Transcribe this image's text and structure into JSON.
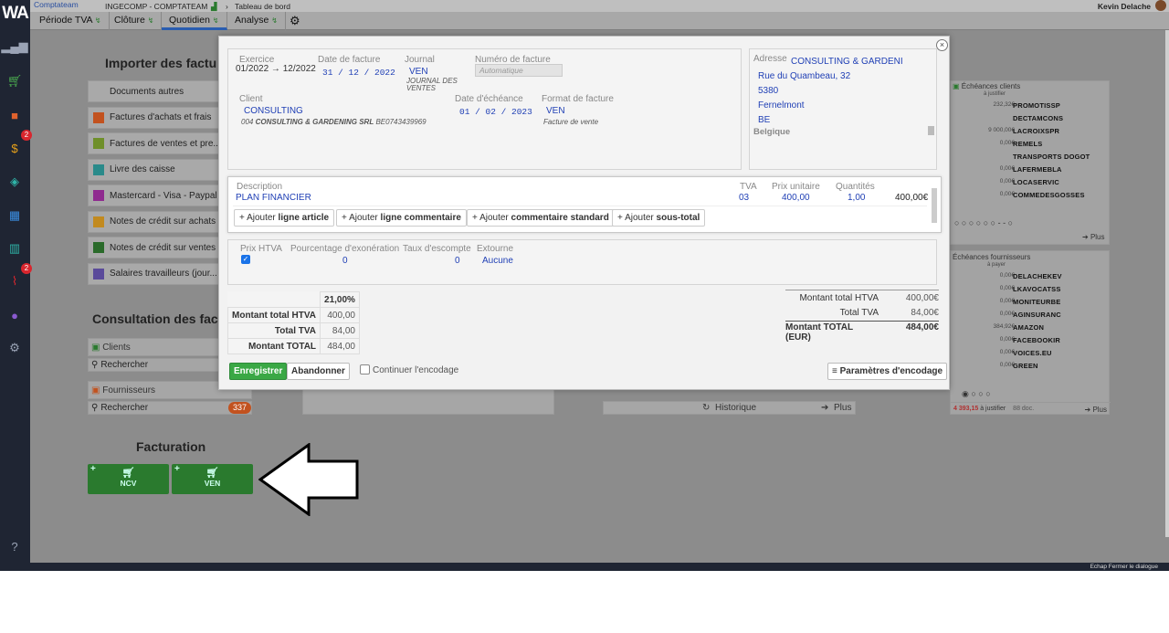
{
  "app": {
    "logo": "WA",
    "brand": "Comptateam",
    "company": "INGECOMP - COMPTATEAM",
    "breadcrumb": "Tableau de bord",
    "user": "Kevin Delache",
    "footer_hint": "Echap Fermer le dialogue"
  },
  "sidebar": {
    "badge_money": "2",
    "badge_attach": "2"
  },
  "tabs": [
    {
      "label": "Période TVA"
    },
    {
      "label": "Clôture"
    },
    {
      "label": "Quotidien"
    },
    {
      "label": "Analyse"
    }
  ],
  "left": {
    "import_title": "Importer des factu",
    "import_items": [
      {
        "label": "Documents autres",
        "color": "#a9a9a9"
      },
      {
        "label": "Factures d'achats et frais",
        "color": "#c2521f"
      },
      {
        "label": "Factures de ventes et pre...",
        "color": "#6f8f2a"
      },
      {
        "label": "Livre des caisse",
        "color": "#2a8a8a"
      },
      {
        "label": "Mastercard - Visa - Paypal",
        "color": "#8f2a8f"
      },
      {
        "label": "Notes de crédit sur achats",
        "color": "#c28a1f"
      },
      {
        "label": "Notes de crédit sur ventes",
        "color": "#2a6a2a"
      },
      {
        "label": "Salaires travailleurs (jour...",
        "color": "#5a4a9a"
      }
    ],
    "consult_title": "Consultation des fac",
    "clients_label": "Clients",
    "clients_search": "Rechercher",
    "suppliers_label": "Fournisseurs",
    "suppliers_search": "Rechercher",
    "suppliers_count": "337",
    "invoicing_title": "Facturation",
    "btn_ncv": "NCV",
    "btn_ven": "VEN"
  },
  "middle": {
    "historique": "Historique",
    "plus": "Plus"
  },
  "right": {
    "clients_title": "Échéances clients",
    "clients_sub": "à justifier",
    "clients": [
      {
        "amount": "232,32€",
        "name": "PROMOTISSP"
      },
      {
        "amount": "",
        "name": "DECTAMCONS"
      },
      {
        "amount": "9 000,00€",
        "name": "LACROIXSPR"
      },
      {
        "amount": "0,00€",
        "name": "REMELS"
      },
      {
        "amount": "",
        "name": "TRANSPORTS DOGOT"
      },
      {
        "amount": "0,00€",
        "name": "LAFERMEBLA"
      },
      {
        "amount": "0,00€",
        "name": "LOCASERVIC"
      },
      {
        "amount": "0,00€",
        "name": "COMMEDESGOSSES"
      }
    ],
    "suppliers_title": "Échéances fournisseurs",
    "suppliers_sub": "à payer",
    "suppliers": [
      {
        "amount": "0,00€",
        "name": "DELACHEKEV"
      },
      {
        "amount": "0,00€",
        "name": "LKAVOCATSS"
      },
      {
        "amount": "0,00€",
        "name": "MONITEURBE"
      },
      {
        "amount": "0,00€",
        "name": "AGINSURANC"
      },
      {
        "amount": "384,92€",
        "name": "AMAZON"
      },
      {
        "amount": "0,00€",
        "name": "FACEBOOKIR"
      },
      {
        "amount": "0,00€",
        "name": "VOICES.EU"
      },
      {
        "amount": "0,00€",
        "name": "GREEN"
      }
    ],
    "plus": "Plus",
    "total_amount": "4 393,15",
    "total_suffix": "à justifier",
    "total_docs": "88 doc."
  },
  "modal": {
    "exercice_label": "Exercice",
    "exercice_value": "01/2022 → 12/2022",
    "date_facture_label": "Date de facture",
    "date_facture": {
      "d": "31",
      "m": "12",
      "y": "2022"
    },
    "journal_label": "Journal",
    "journal_value": "VEN",
    "journal_sub": "JOURNAL DES VENTES",
    "numero_label": "Numéro de facture",
    "numero_placeholder": "Automatique",
    "client_label": "Client",
    "client_value": "CONSULTING",
    "client_sub_code": "004",
    "client_sub_name": "CONSULTING & GARDENING SRL",
    "client_sub_vat": "BE0743439969",
    "echeance_label": "Date d'échéance",
    "echeance": {
      "d": "01",
      "m": "02",
      "y": "2023"
    },
    "format_label": "Format de facture",
    "format_value": "VEN",
    "format_sub": "Facture de vente",
    "address_label": "Adresse",
    "address_lines": [
      "CONSULTING & GARDENI",
      "Rue du Quambeau, 32",
      "5380",
      "Fernelmont",
      "BE"
    ],
    "address_country": "Belgique",
    "line_headers": {
      "description": "Description",
      "tva": "TVA",
      "prix": "Prix unitaire",
      "qte": "Quantités"
    },
    "line": {
      "description": "PLAN FINANCIER",
      "tva": "03",
      "prix": "400,00",
      "qte": "1,00",
      "total": "400,00€"
    },
    "add_buttons": [
      {
        "prefix": "Ajouter",
        "bold": "ligne article"
      },
      {
        "prefix": "Ajouter",
        "bold": "ligne commentaire"
      },
      {
        "prefix": "Ajouter",
        "bold": "commentaire standard"
      },
      {
        "prefix": "Ajouter",
        "bold": "sous-total"
      }
    ],
    "opts": {
      "prix_htva_label": "Prix HTVA",
      "exo_label": "Pourcentage d'exonération",
      "exo_value": "0",
      "escompte_label": "Taux d'escompte",
      "escompte_value": "0",
      "extourne_label": "Extourne",
      "extourne_value": "Aucune"
    },
    "vat_table": {
      "rate": "21,00%",
      "rows": [
        {
          "label": "Montant total HTVA",
          "value": "400,00"
        },
        {
          "label": "Total TVA",
          "value": "84,00"
        },
        {
          "label": "Montant TOTAL",
          "value": "484,00"
        }
      ]
    },
    "totals": [
      {
        "label": "Montant total HTVA",
        "value": "400,00€"
      },
      {
        "label": "Total TVA",
        "value": "84,00€"
      },
      {
        "label": "Montant TOTAL (EUR)",
        "value": "484,00€"
      }
    ],
    "btn_save": "Enregistrer",
    "btn_cancel": "Abandonner",
    "continue_label": "Continuer l'encodage",
    "btn_params": "Paramètres d'encodage"
  }
}
